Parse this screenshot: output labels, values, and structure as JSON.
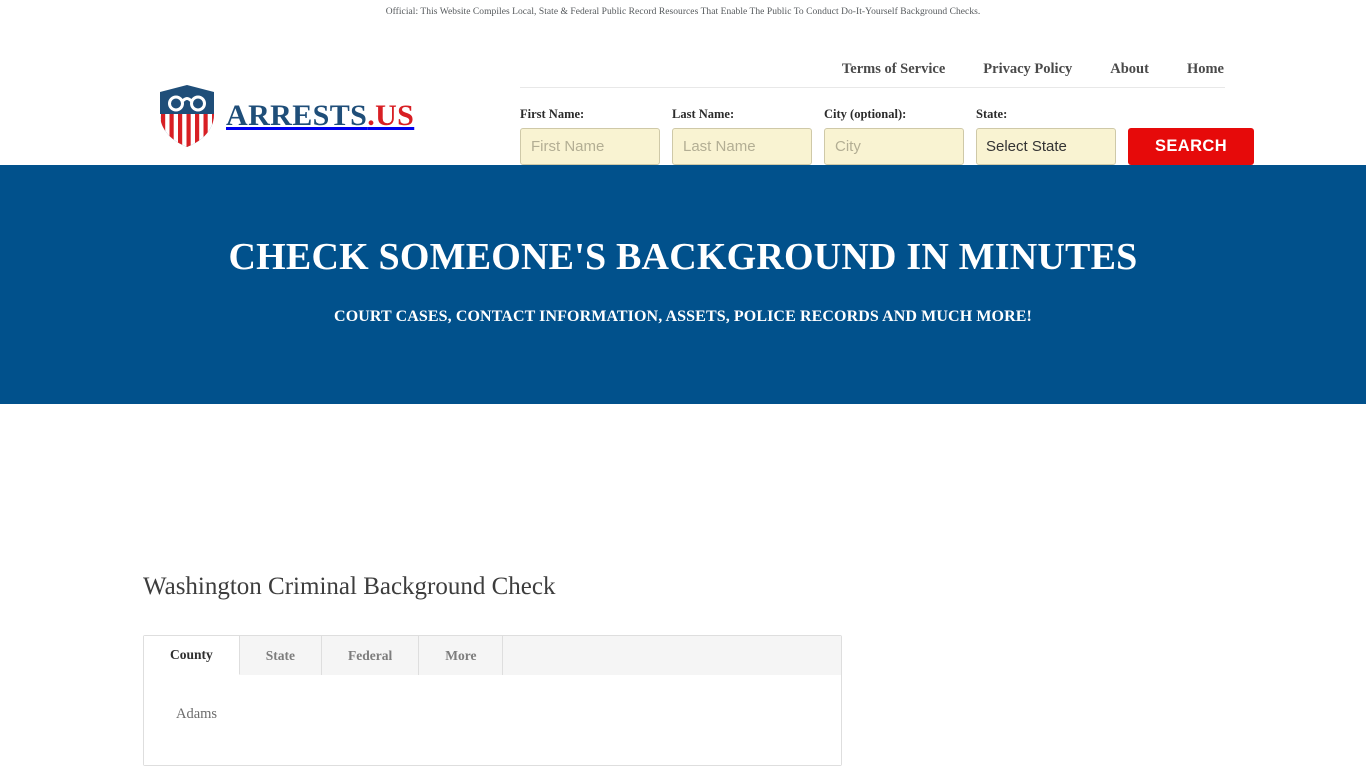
{
  "disclaimer": {
    "text": "Official: This Website Compiles Local, State & Federal Public Record Resources That Enable The Public To Conduct Do-It-Yourself Background Checks."
  },
  "brand": {
    "name_primary": "ARRESTS",
    "name_suffix": ".US",
    "logo_icon": "shield-handcuffs-icon",
    "color_primary": "#1F4E79",
    "color_suffix": "#D81F24"
  },
  "nav": {
    "items": [
      {
        "label": "Terms of Service"
      },
      {
        "label": "Privacy Policy"
      },
      {
        "label": "About"
      },
      {
        "label": "Home"
      }
    ]
  },
  "search": {
    "fields": [
      {
        "label": "First Name:",
        "placeholder": "First Name",
        "value": ""
      },
      {
        "label": "Last Name:",
        "placeholder": "Last Name",
        "value": ""
      },
      {
        "label": "City (optional):",
        "placeholder": "City",
        "value": ""
      }
    ],
    "state_field": {
      "label": "State:",
      "selected": "Select State"
    },
    "submit_label": "SEARCH",
    "submit_color": "#E60A0A",
    "input_background": "#F9F3D2"
  },
  "hero": {
    "title": "CHECK SOMEONE'S BACKGROUND IN MINUTES",
    "subtitle": "COURT CASES, CONTACT INFORMATION, ASSETS, POLICE RECORDS AND MUCH MORE!",
    "background_color": "#01518C"
  },
  "main": {
    "page_title": "Washington Criminal Background Check",
    "tabs": [
      {
        "label": "County",
        "active": true
      },
      {
        "label": "State",
        "active": false
      },
      {
        "label": "Federal",
        "active": false
      },
      {
        "label": "More",
        "active": false
      }
    ],
    "county_list": [
      {
        "name": "Adams"
      }
    ]
  }
}
